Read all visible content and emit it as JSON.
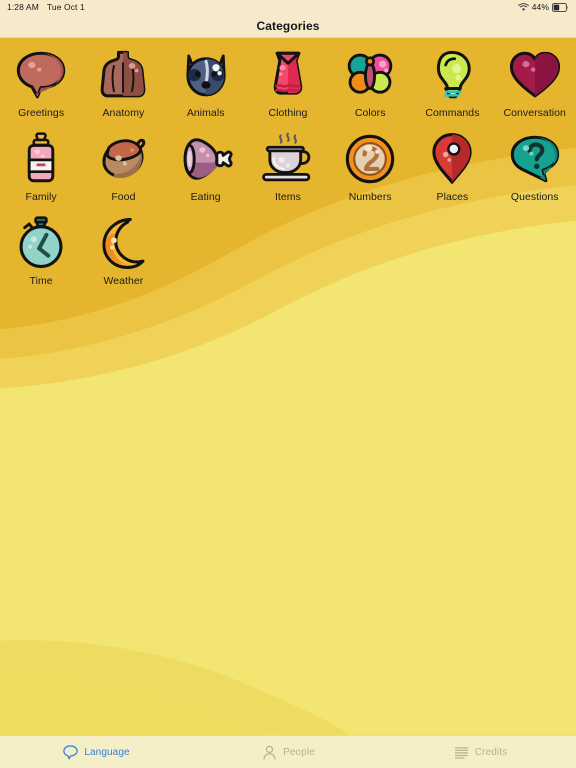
{
  "status_bar": {
    "time": "1:28 AM",
    "date": "Tue Oct 1",
    "wifi_icon": "wifi-icon",
    "battery_percent": "44%",
    "battery_icon": "battery-icon"
  },
  "navbar": {
    "title": "Categories"
  },
  "colors": {
    "header_bg": "#F7EACB",
    "content_top": "#E6B52E",
    "content_bottom": "#F2E571",
    "tabbar_bg": "#F5EFC8",
    "tab_active": "#2f7fe0",
    "tab_inactive": "#b9b486",
    "label_text": "#1b1b1f"
  },
  "categories": [
    {
      "label": "Greetings",
      "icon": "speech-bubble-icon"
    },
    {
      "label": "Anatomy",
      "icon": "torso-icon"
    },
    {
      "label": "Animals",
      "icon": "raccoon-face-icon"
    },
    {
      "label": "Clothing",
      "icon": "dress-icon"
    },
    {
      "label": "Colors",
      "icon": "butterfly-icon"
    },
    {
      "label": "Commands",
      "icon": "lightbulb-icon"
    },
    {
      "label": "Conversation",
      "icon": "heart-icon"
    },
    {
      "label": "Family",
      "icon": "baby-bottle-icon"
    },
    {
      "label": "Food",
      "icon": "acorn-icon"
    },
    {
      "label": "Eating",
      "icon": "ham-icon"
    },
    {
      "label": "Items",
      "icon": "teacup-icon"
    },
    {
      "label": "Numbers",
      "icon": "coin-two-icon"
    },
    {
      "label": "Places",
      "icon": "map-pin-icon"
    },
    {
      "label": "Questions",
      "icon": "question-bubble-icon"
    },
    {
      "label": "Time",
      "icon": "stopwatch-icon"
    },
    {
      "label": "Weather",
      "icon": "crescent-moon-icon"
    }
  ],
  "tabs": [
    {
      "label": "Language",
      "icon": "speech-bubble-outline-icon",
      "active": true
    },
    {
      "label": "People",
      "icon": "person-outline-icon",
      "active": false
    },
    {
      "label": "Credits",
      "icon": "lines-list-icon",
      "active": false
    }
  ]
}
